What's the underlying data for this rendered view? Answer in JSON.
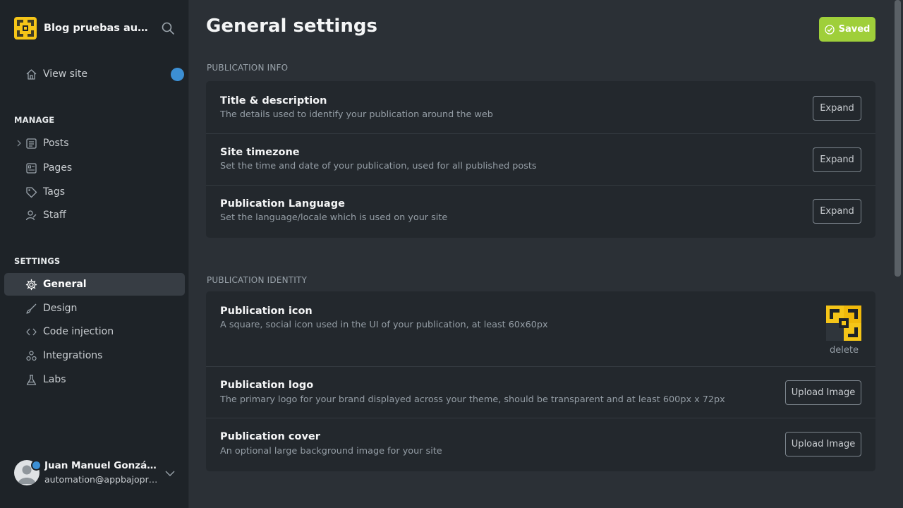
{
  "sidebar": {
    "site_name": "Blog pruebas automatizadas",
    "view_site": "View site",
    "manage_heading": "MANAGE",
    "manage_items": [
      {
        "label": "Posts",
        "icon": "posts-icon"
      },
      {
        "label": "Pages",
        "icon": "pages-icon"
      },
      {
        "label": "Tags",
        "icon": "tag-icon"
      },
      {
        "label": "Staff",
        "icon": "staff-icon"
      }
    ],
    "settings_heading": "SETTINGS",
    "settings_items": [
      {
        "label": "General",
        "icon": "gear-icon",
        "active": true
      },
      {
        "label": "Design",
        "icon": "brush-icon"
      },
      {
        "label": "Code injection",
        "icon": "code-icon"
      },
      {
        "label": "Integrations",
        "icon": "integrations-icon"
      },
      {
        "label": "Labs",
        "icon": "flask-icon"
      }
    ],
    "user": {
      "name": "Juan Manuel González",
      "email": "automation@appbajopruebas.com"
    }
  },
  "main": {
    "title": "General settings",
    "saved_label": "Saved",
    "publication_info": {
      "heading": "PUBLICATION INFO",
      "rows": [
        {
          "title": "Title & description",
          "desc": "The details used to identify your publication around the web",
          "button": "Expand"
        },
        {
          "title": "Site timezone",
          "desc": "Set the time and date of your publication, used for all published posts",
          "button": "Expand"
        },
        {
          "title": "Publication Language",
          "desc": "Set the language/locale which is used on your site",
          "button": "Expand"
        }
      ]
    },
    "publication_identity": {
      "heading": "PUBLICATION IDENTITY",
      "icon_row": {
        "title": "Publication icon",
        "desc": "A square, social icon used in the UI of your publication, at least 60x60px",
        "delete_label": "delete"
      },
      "logo_row": {
        "title": "Publication logo",
        "desc": "The primary logo for your brand displayed across your theme, should be transparent and at least 600px x 72px",
        "button": "Upload Image"
      },
      "cover_row": {
        "title": "Publication cover",
        "desc": "An optional large background image for your site",
        "button": "Upload Image"
      }
    }
  },
  "colors": {
    "accent_green": "#9fcf3a",
    "notification_blue": "#3c8fd4",
    "logo_yellow": "#f5c518"
  }
}
